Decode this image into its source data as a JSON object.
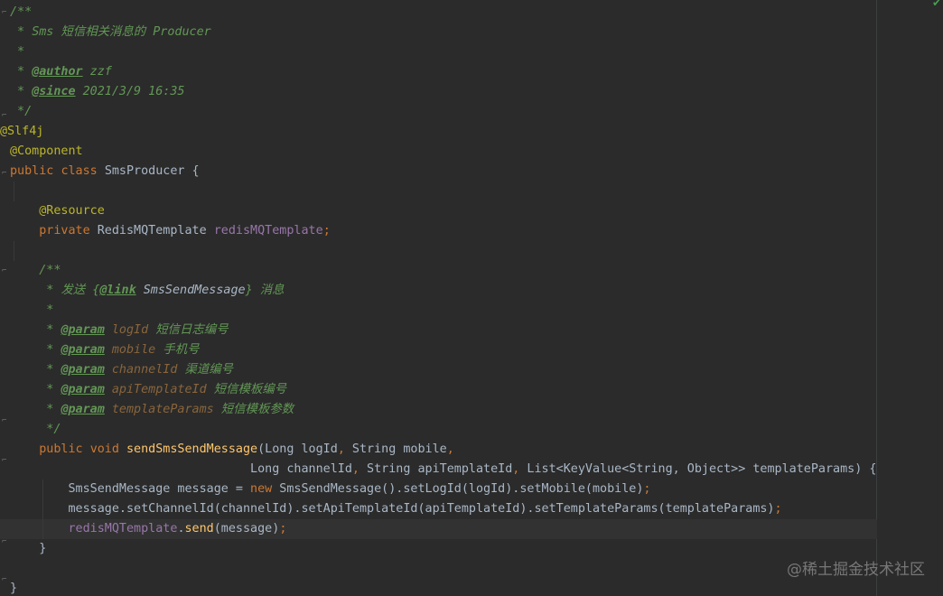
{
  "status": {
    "check_icon": "checkmark-icon"
  },
  "watermark": {
    "text": "@稀土掘金技术社区"
  },
  "colors": {
    "background": "#2b2b2b",
    "doc_comment": "#629755",
    "keyword": "#cc7832",
    "annotation": "#bbb529",
    "field": "#9876aa",
    "method": "#ffc66d",
    "plain": "#a9b7c6"
  },
  "code": {
    "l1": {
      "open": "/**"
    },
    "l2": {
      "star": " * ",
      "text": "Sms 短信相关消息的 Producer"
    },
    "l3": {
      "star": " *"
    },
    "l4": {
      "star": " * ",
      "tag": "@author",
      "value": " zzf"
    },
    "l5": {
      "star": " * ",
      "tag": "@since",
      "value": " 2021/3/9 16:35"
    },
    "l6": {
      "close": " */"
    },
    "l7": {
      "annotation": "@Slf4j"
    },
    "l8": {
      "annotation": "@Component"
    },
    "l9": {
      "kw1": "public",
      "kw2": "class",
      "name": "SmsProducer",
      "brace": " {"
    },
    "l11": {
      "annotation": "@Resource"
    },
    "l12": {
      "kw": "private",
      "type": "RedisMQTemplate",
      "field": "redisMQTemplate",
      "semi": ";"
    },
    "l14": {
      "open": "/**"
    },
    "l15": {
      "star": " * ",
      "pre": "发送 {",
      "tag": "@link",
      "ref": " SmsSendMessage",
      "post": "} 消息"
    },
    "l16": {
      "star": " *"
    },
    "p1": {
      "star": " * ",
      "tag": "@param",
      "name": " logId",
      "desc": " 短信日志编号"
    },
    "p2": {
      "star": " * ",
      "tag": "@param",
      "name": " mobile",
      "desc": " 手机号"
    },
    "p3": {
      "star": " * ",
      "tag": "@param",
      "name": " channelId",
      "desc": " 渠道编号"
    },
    "p4": {
      "star": " * ",
      "tag": "@param",
      "name": " apiTemplateId",
      "desc": " 短信模板编号"
    },
    "p5": {
      "star": " * ",
      "tag": "@param",
      "name": " templateParams",
      "desc": " 短信模板参数"
    },
    "l22": {
      "close": " */"
    },
    "l23": {
      "kw1": "public",
      "kw2": "void",
      "method": "sendSmsSendMessage",
      "params": "(Long logId",
      "comma": ",",
      "params2": " String mobile",
      "comma2": ","
    },
    "l24": {
      "indent": "                                 ",
      "a": "Long channelId",
      "c1": ",",
      "b": " String apiTemplateId",
      "c2": ",",
      "c": " List<KeyValue<String, Object>> templateParams) {"
    },
    "l25": {
      "a": "SmsSendMessage message = ",
      "kw": "new",
      "b": " SmsSendMessage().setLogId(logId).setMobile(mobile)",
      "semi": ";"
    },
    "l26": {
      "a": "message.setChannelId(channelId).setApiTemplateId(apiTemplateId).setTemplateParams(templateParams)",
      "semi": ";"
    },
    "l27": {
      "field": "redisMQTemplate",
      "a": ".",
      "method": "send",
      "b": "(message)",
      "semi": ";"
    },
    "l28": {
      "brace": "}"
    },
    "l30": {
      "brace": "}"
    }
  }
}
